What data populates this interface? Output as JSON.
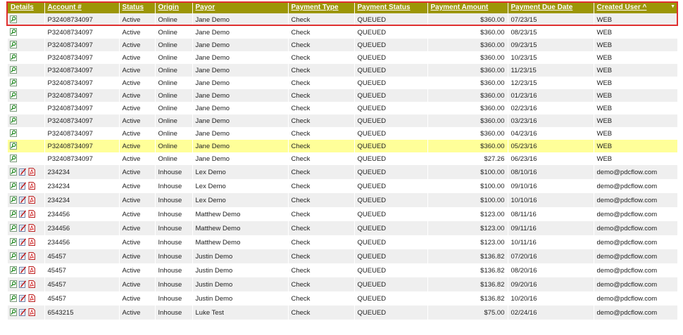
{
  "columns": [
    "Details",
    "Account #",
    "Status",
    "Origin",
    "Payor",
    "Payment Type",
    "Payment Status",
    "Payment Amount",
    "Payment Due Date",
    "Created User ^"
  ],
  "sort_arrow": "▼",
  "rows": [
    {
      "actions": [
        "view"
      ],
      "account": "P32408734097",
      "status": "Active",
      "origin": "Online",
      "payor": "Jane Demo",
      "type": "Check",
      "pstatus": "QUEUED",
      "amount": "$360.00",
      "due": "07/23/15",
      "user": "WEB"
    },
    {
      "actions": [
        "view"
      ],
      "account": "P32408734097",
      "status": "Active",
      "origin": "Online",
      "payor": "Jane Demo",
      "type": "Check",
      "pstatus": "QUEUED",
      "amount": "$360.00",
      "due": "08/23/15",
      "user": "WEB"
    },
    {
      "actions": [
        "view"
      ],
      "account": "P32408734097",
      "status": "Active",
      "origin": "Online",
      "payor": "Jane Demo",
      "type": "Check",
      "pstatus": "QUEUED",
      "amount": "$360.00",
      "due": "09/23/15",
      "user": "WEB"
    },
    {
      "actions": [
        "view"
      ],
      "account": "P32408734097",
      "status": "Active",
      "origin": "Online",
      "payor": "Jane Demo",
      "type": "Check",
      "pstatus": "QUEUED",
      "amount": "$360.00",
      "due": "10/23/15",
      "user": "WEB"
    },
    {
      "actions": [
        "view"
      ],
      "account": "P32408734097",
      "status": "Active",
      "origin": "Online",
      "payor": "Jane Demo",
      "type": "Check",
      "pstatus": "QUEUED",
      "amount": "$360.00",
      "due": "11/23/15",
      "user": "WEB"
    },
    {
      "actions": [
        "view"
      ],
      "account": "P32408734097",
      "status": "Active",
      "origin": "Online",
      "payor": "Jane Demo",
      "type": "Check",
      "pstatus": "QUEUED",
      "amount": "$360.00",
      "due": "12/23/15",
      "user": "WEB"
    },
    {
      "actions": [
        "view"
      ],
      "account": "P32408734097",
      "status": "Active",
      "origin": "Online",
      "payor": "Jane Demo",
      "type": "Check",
      "pstatus": "QUEUED",
      "amount": "$360.00",
      "due": "01/23/16",
      "user": "WEB"
    },
    {
      "actions": [
        "view"
      ],
      "account": "P32408734097",
      "status": "Active",
      "origin": "Online",
      "payor": "Jane Demo",
      "type": "Check",
      "pstatus": "QUEUED",
      "amount": "$360.00",
      "due": "02/23/16",
      "user": "WEB"
    },
    {
      "actions": [
        "view"
      ],
      "account": "P32408734097",
      "status": "Active",
      "origin": "Online",
      "payor": "Jane Demo",
      "type": "Check",
      "pstatus": "QUEUED",
      "amount": "$360.00",
      "due": "03/23/16",
      "user": "WEB"
    },
    {
      "actions": [
        "view"
      ],
      "account": "P32408734097",
      "status": "Active",
      "origin": "Online",
      "payor": "Jane Demo",
      "type": "Check",
      "pstatus": "QUEUED",
      "amount": "$360.00",
      "due": "04/23/16",
      "user": "WEB"
    },
    {
      "actions": [
        "view"
      ],
      "account": "P32408734097",
      "status": "Active",
      "origin": "Online",
      "payor": "Jane Demo",
      "type": "Check",
      "pstatus": "QUEUED",
      "amount": "$360.00",
      "due": "05/23/16",
      "user": "WEB",
      "highlighted": true
    },
    {
      "actions": [
        "view"
      ],
      "account": "P32408734097",
      "status": "Active",
      "origin": "Online",
      "payor": "Jane Demo",
      "type": "Check",
      "pstatus": "QUEUED",
      "amount": "$27.26",
      "due": "06/23/16",
      "user": "WEB"
    },
    {
      "actions": [
        "view",
        "edit",
        "pdf"
      ],
      "account": "234234",
      "status": "Active",
      "origin": "Inhouse",
      "payor": "Lex Demo",
      "type": "Check",
      "pstatus": "QUEUED",
      "amount": "$100.00",
      "due": "08/10/16",
      "user": "demo@pdcflow.com"
    },
    {
      "actions": [
        "view",
        "edit",
        "pdf"
      ],
      "account": "234234",
      "status": "Active",
      "origin": "Inhouse",
      "payor": "Lex Demo",
      "type": "Check",
      "pstatus": "QUEUED",
      "amount": "$100.00",
      "due": "09/10/16",
      "user": "demo@pdcflow.com"
    },
    {
      "actions": [
        "view",
        "edit",
        "pdf"
      ],
      "account": "234234",
      "status": "Active",
      "origin": "Inhouse",
      "payor": "Lex Demo",
      "type": "Check",
      "pstatus": "QUEUED",
      "amount": "$100.00",
      "due": "10/10/16",
      "user": "demo@pdcflow.com"
    },
    {
      "actions": [
        "view",
        "edit",
        "pdf"
      ],
      "account": "234456",
      "status": "Active",
      "origin": "Inhouse",
      "payor": "Matthew Demo",
      "type": "Check",
      "pstatus": "QUEUED",
      "amount": "$123.00",
      "due": "08/11/16",
      "user": "demo@pdcflow.com"
    },
    {
      "actions": [
        "view",
        "edit",
        "pdf"
      ],
      "account": "234456",
      "status": "Active",
      "origin": "Inhouse",
      "payor": "Matthew Demo",
      "type": "Check",
      "pstatus": "QUEUED",
      "amount": "$123.00",
      "due": "09/11/16",
      "user": "demo@pdcflow.com"
    },
    {
      "actions": [
        "view",
        "edit",
        "pdf"
      ],
      "account": "234456",
      "status": "Active",
      "origin": "Inhouse",
      "payor": "Matthew Demo",
      "type": "Check",
      "pstatus": "QUEUED",
      "amount": "$123.00",
      "due": "10/11/16",
      "user": "demo@pdcflow.com"
    },
    {
      "actions": [
        "view",
        "edit",
        "pdf"
      ],
      "account": "45457",
      "status": "Active",
      "origin": "Inhouse",
      "payor": "Justin Demo",
      "type": "Check",
      "pstatus": "QUEUED",
      "amount": "$136.82",
      "due": "07/20/16",
      "user": "demo@pdcflow.com"
    },
    {
      "actions": [
        "view",
        "edit",
        "pdf"
      ],
      "account": "45457",
      "status": "Active",
      "origin": "Inhouse",
      "payor": "Justin Demo",
      "type": "Check",
      "pstatus": "QUEUED",
      "amount": "$136.82",
      "due": "08/20/16",
      "user": "demo@pdcflow.com"
    },
    {
      "actions": [
        "view",
        "edit",
        "pdf"
      ],
      "account": "45457",
      "status": "Active",
      "origin": "Inhouse",
      "payor": "Justin Demo",
      "type": "Check",
      "pstatus": "QUEUED",
      "amount": "$136.82",
      "due": "09/20/16",
      "user": "demo@pdcflow.com"
    },
    {
      "actions": [
        "view",
        "edit",
        "pdf"
      ],
      "account": "45457",
      "status": "Active",
      "origin": "Inhouse",
      "payor": "Justin Demo",
      "type": "Check",
      "pstatus": "QUEUED",
      "amount": "$136.82",
      "due": "10/20/16",
      "user": "demo@pdcflow.com"
    },
    {
      "actions": [
        "view",
        "edit",
        "pdf"
      ],
      "account": "6543215",
      "status": "Active",
      "origin": "Inhouse",
      "payor": "Luke Test",
      "type": "Check",
      "pstatus": "QUEUED",
      "amount": "$75.00",
      "due": "02/24/16",
      "user": "demo@pdcflow.com"
    }
  ]
}
